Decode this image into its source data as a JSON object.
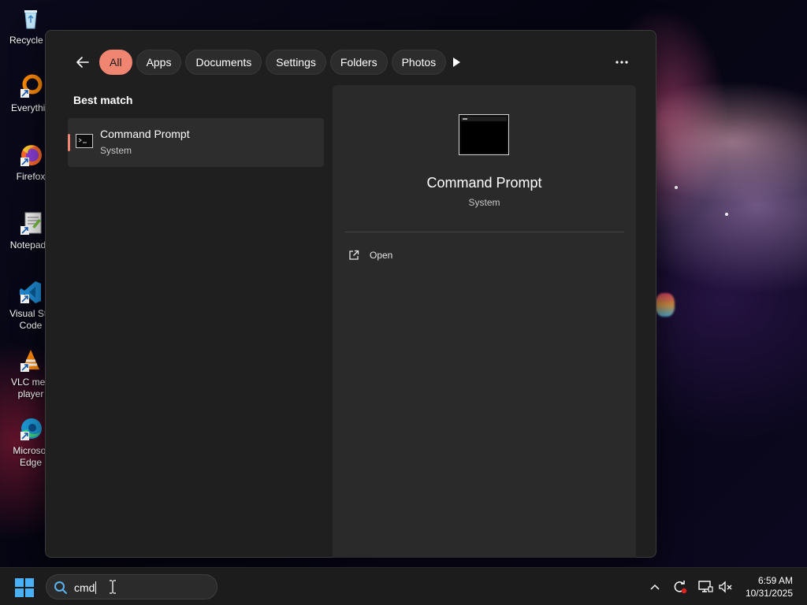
{
  "desktop": {
    "icons": [
      {
        "label": "Recycle B",
        "icon": "recycle-bin-icon"
      },
      {
        "label": "Everythin",
        "icon": "everything-app-icon"
      },
      {
        "label": "Firefox",
        "icon": "firefox-icon"
      },
      {
        "label": "Notepad+",
        "icon": "notepad-plus-plus-icon"
      },
      {
        "label": "Visual Stu\nCode",
        "icon": "vscode-icon"
      },
      {
        "label": "VLC med\nplayer",
        "icon": "vlc-icon"
      },
      {
        "label": "Microsof\nEdge",
        "icon": "edge-icon"
      }
    ]
  },
  "search_panel": {
    "filters": [
      {
        "label": "All",
        "active": true
      },
      {
        "label": "Apps",
        "active": false
      },
      {
        "label": "Documents",
        "active": false
      },
      {
        "label": "Settings",
        "active": false
      },
      {
        "label": "Folders",
        "active": false
      },
      {
        "label": "Photos",
        "active": false
      }
    ],
    "best_match_heading": "Best match",
    "best_match": {
      "title": "Command Prompt",
      "subtitle": "System",
      "icon": "command-prompt-icon"
    },
    "detail": {
      "title": "Command Prompt",
      "subtitle": "System",
      "actions": [
        {
          "label": "Open",
          "icon": "open-external-icon"
        }
      ]
    }
  },
  "taskbar": {
    "search_query": "cmd",
    "clock": {
      "time": "6:59 AM",
      "date": "10/31/2025"
    },
    "tray_icons": [
      "chevron-up-icon",
      "sync-icon",
      "display-icon",
      "volume-muted-icon"
    ]
  },
  "colors": {
    "accent": "#f08572",
    "panel_bg": "#1f1f1f",
    "detail_bg": "#2a2a2a",
    "taskbar_bg": "#1c1c1c"
  }
}
